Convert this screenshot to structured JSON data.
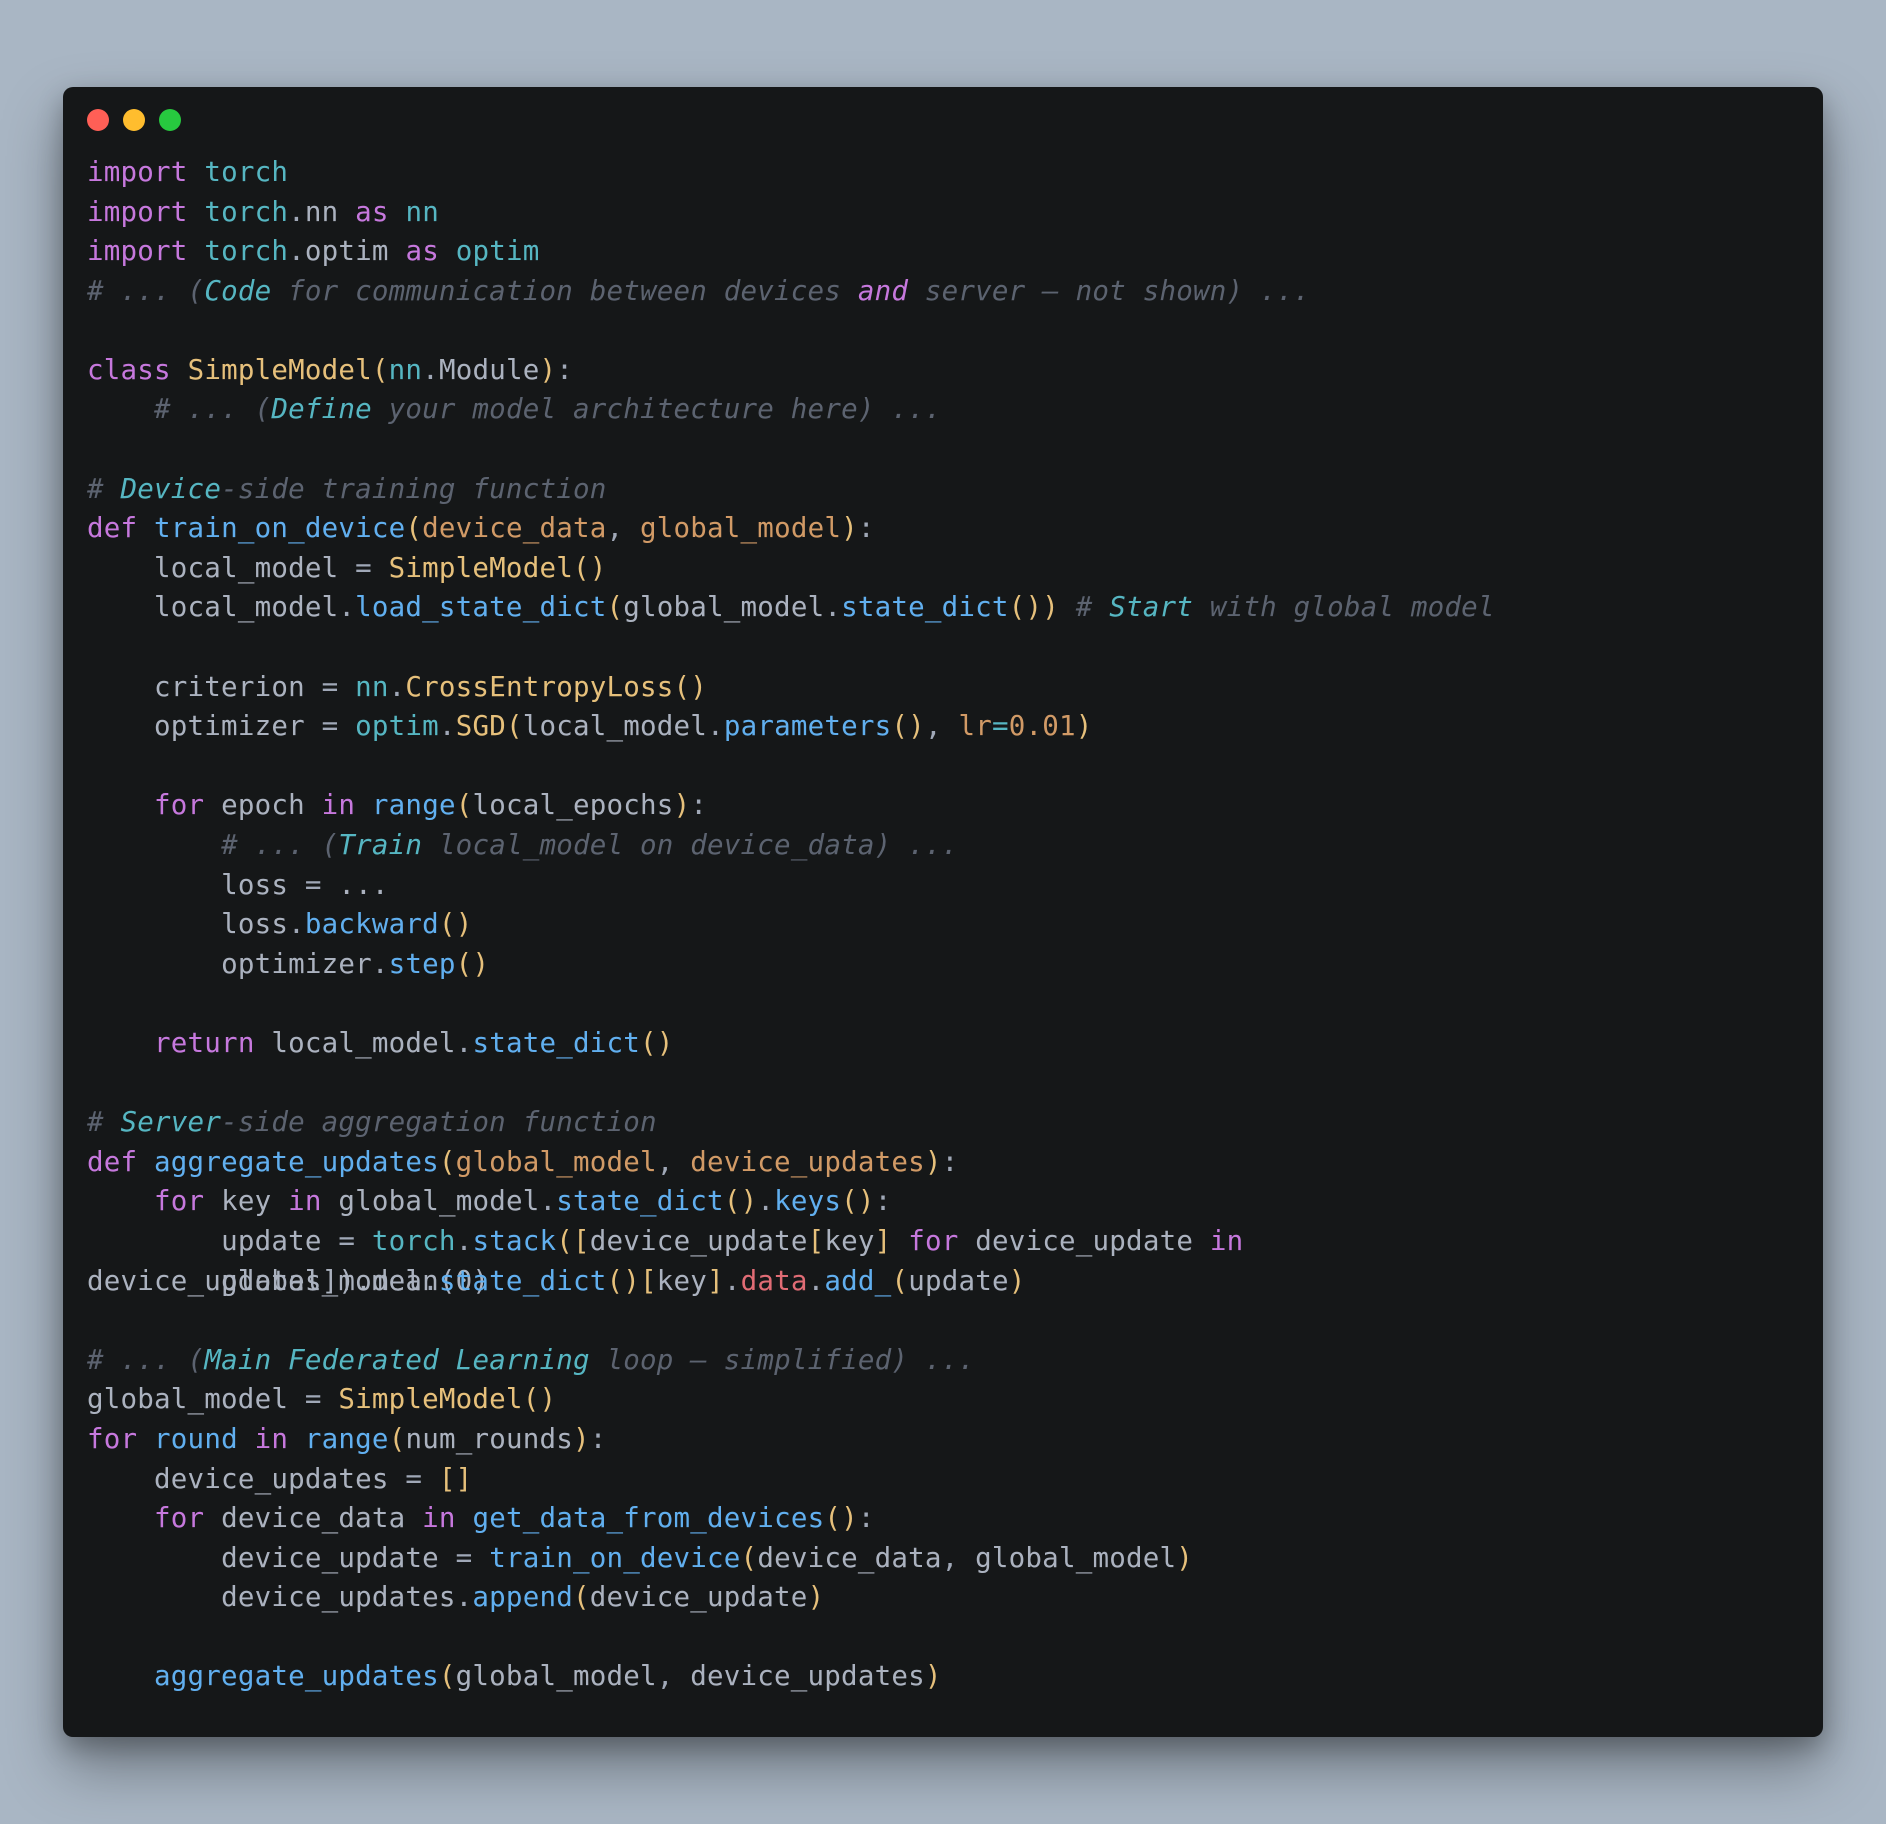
{
  "window": {
    "buttons": [
      "close",
      "minimize",
      "zoom"
    ]
  },
  "code": {
    "line1": {
      "kw": "import",
      "mod": "torch"
    },
    "line2": {
      "kw": "import",
      "mod1": "torch",
      "sub": "nn",
      "as": "as",
      "alias": "nn"
    },
    "line3": {
      "kw": "import",
      "mod1": "torch",
      "sub": "optim",
      "as": "as",
      "alias": "optim"
    },
    "line4": {
      "hash": "#",
      "t1": " ... (",
      "w1": "Code",
      "t2": " for communication between devices ",
      "w2": "and",
      "t3": " server – not shown) ..."
    },
    "line6": {
      "kw": "class",
      "name": "SimpleModel",
      "lp": "(",
      "base1": "nn",
      "dot": ".",
      "base2": "Module",
      "rp": ")",
      "colon": ":"
    },
    "line7": {
      "indent": "    ",
      "hash": "#",
      "t1": " ... (",
      "w1": "Define",
      "t2": " your model architecture here) ..."
    },
    "line9": {
      "hash": "#",
      "t1": " ",
      "w1": "Device",
      "t2": "-side training function"
    },
    "line10": {
      "kw": "def",
      "name": "train_on_device",
      "lp": "(",
      "p1": "device_data",
      "c": ", ",
      "p2": "global_model",
      "rp": ")",
      "colon": ":"
    },
    "line11": {
      "indent": "    ",
      "lhs": "local_model",
      "eq": " = ",
      "cls": "SimpleModel",
      "lp": "(",
      "rp": ")"
    },
    "line12": {
      "indent": "    ",
      "obj": "local_model",
      "dot": ".",
      "m": "load_state_dict",
      "lp": "(",
      "a1": "global_model",
      "d2": ".",
      "m2": "state_dict",
      "lp2": "(",
      "rp2": ")",
      "rp": ")",
      "sp": " ",
      "hash": "#",
      "ct": " ",
      "cw": "Start",
      "ct2": " with global model"
    },
    "line14": {
      "indent": "    ",
      "lhs": "criterion",
      "eq": " = ",
      "ns": "nn",
      "dot": ".",
      "cls": "CrossEntropyLoss",
      "lp": "(",
      "rp": ")"
    },
    "line15": {
      "indent": "    ",
      "lhs": "optimizer",
      "eq": " = ",
      "ns": "optim",
      "dot": ".",
      "cls": "SGD",
      "lp": "(",
      "a1": "local_model",
      "d2": ".",
      "m2": "parameters",
      "lp2": "(",
      "rp2": ")",
      "c": ", ",
      "kwarg": "lr",
      "keq": "=",
      "val": "0.01",
      "rp": ")"
    },
    "line17": {
      "indent": "    ",
      "kw1": "for",
      "var": "epoch",
      "kw2": "in",
      "fn": "range",
      "lp": "(",
      "arg": "local_epochs",
      "rp": ")",
      "colon": ":"
    },
    "line18": {
      "indent": "        ",
      "hash": "#",
      "t1": " ... (",
      "w1": "Train",
      "t2": " local_model on device_data) ..."
    },
    "line19": {
      "indent": "        ",
      "lhs": "loss",
      "eq": " = ",
      "rhs": "..."
    },
    "line20": {
      "indent": "        ",
      "obj": "loss",
      "dot": ".",
      "m": "backward",
      "lp": "(",
      "rp": ")"
    },
    "line21": {
      "indent": "        ",
      "obj": "optimizer",
      "dot": ".",
      "m": "step",
      "lp": "(",
      "rp": ")"
    },
    "line23": {
      "indent": "    ",
      "kw": "return",
      "obj": "local_model",
      "dot": ".",
      "m": "state_dict",
      "lp": "(",
      "rp": ")"
    },
    "line25": {
      "hash": "#",
      "t1": " ",
      "w1": "Server",
      "t2": "-side aggregation function"
    },
    "line26": {
      "kw": "def",
      "name": "aggregate_updates",
      "lp": "(",
      "p1": "global_model",
      "c": ", ",
      "p2": "device_updates",
      "rp": ")",
      "colon": ":"
    },
    "line27": {
      "indent": "    ",
      "kw1": "for",
      "var": "key",
      "kw2": "in",
      "obj": "global_model",
      "dot": ".",
      "m": "state_dict",
      "lp": "(",
      "rp": ")",
      "d2": ".",
      "m2": "keys",
      "lp2": "(",
      "rp2": ")",
      "colon": ":"
    },
    "line28": {
      "indent": "        ",
      "lhs": "update",
      "eq": " = ",
      "ns": "torch",
      "dot": ".",
      "m": "stack",
      "lp": "(",
      "lb": "[",
      "a1": "device_update",
      "lb2": "[",
      "k": "key",
      "rb2": "]",
      "sp": " ",
      "kw1": "for",
      "sp2": " ",
      "a2": "device_update",
      "sp3": " ",
      "kw2": "in"
    },
    "line29a": {
      "pre": "device_updates]).mean(0)"
    },
    "line29b": {
      "indent": "        ",
      "obj": "global_model",
      "dot": ".",
      "m": "state_dict",
      "lp": "(",
      "rp": ")",
      "lb": "[",
      "k": "key",
      "rb": "]",
      "d2": ".",
      "attr": "data",
      "d3": ".",
      "m2": "add_",
      "lp2": "(",
      "arg": "update",
      "rp2": ")"
    },
    "line31": {
      "hash": "#",
      "t1": " ... (",
      "w1": "Main",
      "t2": " ",
      "w2": "Federated",
      "t3": " ",
      "w3": "Learning",
      "t4": " loop – simplified) ..."
    },
    "line32": {
      "lhs": "global_model",
      "eq": " = ",
      "cls": "SimpleModel",
      "lp": "(",
      "rp": ")"
    },
    "line33": {
      "kw1": "for",
      "var": "round",
      "kw2": "in",
      "fn": "range",
      "lp": "(",
      "arg": "num_rounds",
      "rp": ")",
      "colon": ":"
    },
    "line34": {
      "indent": "    ",
      "lhs": "device_updates",
      "eq": " = ",
      "lb": "[",
      "rb": "]"
    },
    "line35": {
      "indent": "    ",
      "kw1": "for",
      "var": "device_data",
      "kw2": "in",
      "fn": "get_data_from_devices",
      "lp": "(",
      "rp": ")",
      "colon": ":"
    },
    "line36": {
      "indent": "        ",
      "lhs": "device_update",
      "eq": " = ",
      "fn": "train_on_device",
      "lp": "(",
      "a1": "device_data",
      "c": ", ",
      "a2": "global_model",
      "rp": ")"
    },
    "line37": {
      "indent": "        ",
      "obj": "device_updates",
      "dot": ".",
      "m": "append",
      "lp": "(",
      "arg": "device_update",
      "rp": ")"
    },
    "line39": {
      "indent": "    ",
      "fn": "aggregate_updates",
      "lp": "(",
      "a1": "global_model",
      "c": ", ",
      "a2": "device_updates",
      "rp": ")"
    }
  }
}
